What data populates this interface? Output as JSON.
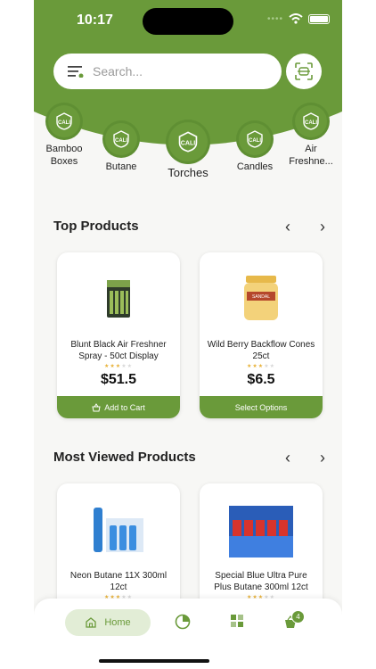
{
  "status_bar": {
    "time": "10:17"
  },
  "search": {
    "placeholder": "Search..."
  },
  "categories": [
    {
      "label": "Bamboo Boxes"
    },
    {
      "label": "Butane"
    },
    {
      "label": "Torches"
    },
    {
      "label": "Candles"
    },
    {
      "label": "Air Freshne..."
    }
  ],
  "top_products": {
    "title": "Top Products",
    "items": [
      {
        "name": "Blunt Black Air Freshner Spray - 50ct Display",
        "price": "$51.5",
        "rating": 3,
        "button": "Add to Cart",
        "icon": "basket-icon"
      },
      {
        "name": "Wild Berry Backflow Cones 25ct",
        "price": "$6.5",
        "rating": 3,
        "button": "Select Options"
      }
    ]
  },
  "most_viewed": {
    "title": "Most Viewed Products",
    "items": [
      {
        "name": "Neon Butane 11X 300ml 12ct",
        "rating": 3
      },
      {
        "name": "Special Blue Ultra Pure Plus Butane 300ml 12ct",
        "rating": 3
      }
    ]
  },
  "bottom_nav": {
    "home_label": "Home",
    "cart_count": "4"
  },
  "colors": {
    "brand_green": "#6a9a3a",
    "pill_bg": "#e2edd6",
    "star": "#e8b23a"
  }
}
